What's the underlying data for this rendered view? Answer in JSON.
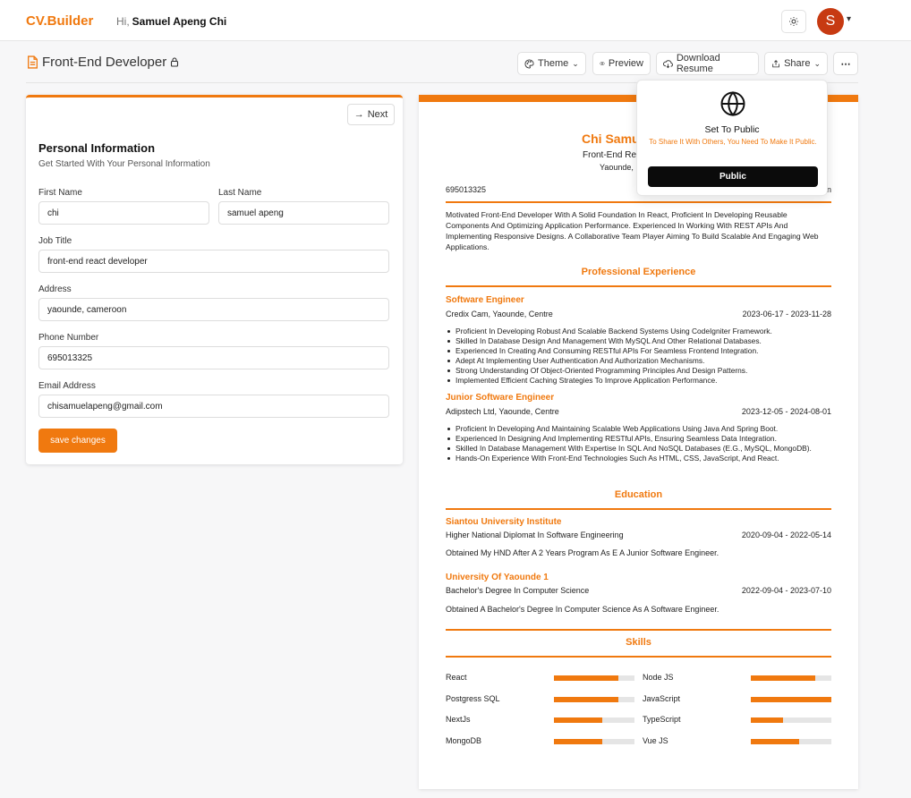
{
  "app": {
    "logo": "CV.Builder",
    "greeting": "Hi,",
    "user_name": "Samuel Apeng Chi",
    "avatar_initial": "S"
  },
  "toolbar": {
    "doc_title": "Front-End Developer",
    "theme": "Theme",
    "preview": "Preview",
    "download": "Download Resume",
    "share": "Share"
  },
  "share_popover": {
    "title": "Set To Public",
    "description": "To Share It With Others, You Need To Make It Public.",
    "button": "Public"
  },
  "form": {
    "next": "Next",
    "heading": "Personal Information",
    "subheading": "Get Started With Your Personal Information",
    "first_name_label": "First Name",
    "first_name": "chi",
    "last_name_label": "Last Name",
    "last_name": "samuel apeng",
    "job_title_label": "Job Title",
    "job_title": "front-end react developer",
    "address_label": "Address",
    "address": "yaounde, cameroon",
    "phone_label": "Phone Number",
    "phone": "695013325",
    "email_label": "Email Address",
    "email": "chisamuelapeng@gmail.com",
    "save": "save changes"
  },
  "resume": {
    "name_visible": "Chi Samu",
    "title_visible": "Front-End Re",
    "address_visible": "Yaounde,",
    "phone": "695013325",
    "contact_tail": "n",
    "summary": "Motivated Front-End Developer With A Solid Foundation In React, Proficient In Developing Reusable Components And Optimizing Application Performance. Experienced In Working With REST APIs And Implementing Responsive Designs. A Collaborative Team Player Aiming To Build Scalable And Engaging Web Applications.",
    "experience_heading": "Professional Experience",
    "experience": [
      {
        "role": "Software Engineer",
        "company": "Credix Cam, Yaounde, Centre",
        "dates": "2023-06-17 - 2023-11-28",
        "bullets": [
          "Proficient In Developing Robust And Scalable Backend Systems Using CodeIgniter Framework.",
          "Skilled In Database Design And Management With MySQL And Other Relational Databases.",
          "Experienced In Creating And Consuming RESTful APIs For Seamless Frontend Integration.",
          "Adept At Implementing User Authentication And Authorization Mechanisms.",
          "Strong Understanding Of Object-Oriented Programming Principles And Design Patterns.",
          "Implemented Efficient Caching Strategies To Improve Application Performance."
        ]
      },
      {
        "role": "Junior Software Engineer",
        "company": "Adipstech Ltd, Yaounde, Centre",
        "dates": "2023-12-05 - 2024-08-01",
        "bullets": [
          "Proficient In Developing And Maintaining Scalable Web Applications Using Java And Spring Boot.",
          "Experienced In Designing And Implementing RESTful APIs, Ensuring Seamless Data Integration.",
          "Skilled In Database Management With Expertise In SQL And NoSQL Databases (E.G., MySQL, MongoDB).",
          "Hands-On Experience With Front-End Technologies Such As HTML, CSS, JavaScript, And React."
        ]
      }
    ],
    "education_heading": "Education",
    "education": [
      {
        "school": "Siantou University Institute",
        "degree": "Higher National Diplomat In Software Engineering",
        "dates": "2020-09-04 - 2022-05-14",
        "description": "Obtained My HND After A 2 Years Program As E A Junior Software Engineer."
      },
      {
        "school": "University Of Yaounde 1",
        "degree": "Bachelor's Degree In Computer Science",
        "dates": "2022-09-04 - 2023-07-10",
        "description": "Obtained A Bachelor's Degree In Computer Science As A Software Engineer."
      }
    ],
    "skills_heading": "Skills",
    "skills": [
      {
        "name": "React",
        "level": 0.8
      },
      {
        "name": "Node JS",
        "level": 0.8
      },
      {
        "name": "Postgress SQL",
        "level": 0.8
      },
      {
        "name": "JavaScript",
        "level": 1.0
      },
      {
        "name": "NextJs",
        "level": 0.6
      },
      {
        "name": "TypeScript",
        "level": 0.4
      },
      {
        "name": "MongoDB",
        "level": 0.6
      },
      {
        "name": "Vue JS",
        "level": 0.6
      }
    ]
  },
  "colors": {
    "accent": "#f0790f",
    "avatar": "#c73a12"
  }
}
